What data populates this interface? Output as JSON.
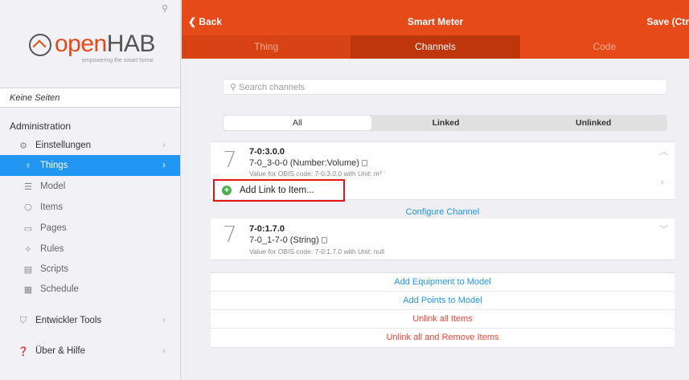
{
  "sidebar": {
    "logo": {
      "open": "open",
      "hab": "HAB",
      "tagline": "empowering the smart home"
    },
    "no_pages": "Keine Seiten",
    "admin_title": "Administration",
    "items": [
      {
        "label": "Einstellungen"
      },
      {
        "label": "Things"
      },
      {
        "label": "Model"
      },
      {
        "label": "Items"
      },
      {
        "label": "Pages"
      },
      {
        "label": "Rules"
      },
      {
        "label": "Scripts"
      },
      {
        "label": "Schedule"
      },
      {
        "label": "Entwickler Tools"
      },
      {
        "label": "Über & Hilfe"
      }
    ]
  },
  "topbar": {
    "back": "Back",
    "title": "Smart Meter",
    "save": "Save (Ctr",
    "tabs": [
      "Thing",
      "Channels",
      "Code"
    ]
  },
  "search": {
    "placeholder": "Search channels"
  },
  "filter": [
    "All",
    "Linked",
    "Unlinked"
  ],
  "channels": [
    {
      "glyph": "7",
      "name": "7-0:3.0.0",
      "type": "7-0_3-0-0 (Number:Volume)",
      "desc": "Value for OBIS code: 7-0:3.0.0 with Unit: m³"
    },
    {
      "glyph": "7",
      "name": "7-0:1.7.0",
      "type": "7-0_1-7-0 (String)",
      "desc": "Value for OBIS code: 7-0:1.7.0 with Unit: null"
    }
  ],
  "add_link": "Add Link to Item...",
  "configure_channel": "Configure Channel",
  "actions": [
    "Add Equipment to Model",
    "Add Points to Model",
    "Unlink all Items",
    "Unlink all and Remove Items"
  ],
  "colors": {
    "accent": "#e64a19",
    "active_nav": "#2196f3",
    "link": "#2196f3",
    "danger": "#f44336"
  }
}
